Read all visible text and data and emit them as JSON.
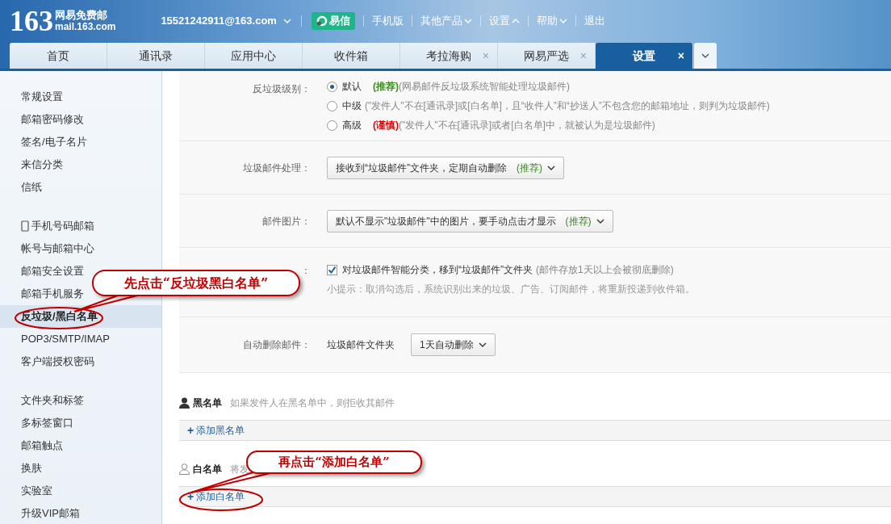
{
  "header": {
    "logo": {
      "number": "163",
      "name": "网易免费邮",
      "domain": "mail.163.com"
    },
    "account": "15521242911@163.com",
    "yixin": "易信",
    "links": [
      {
        "label": "手机版",
        "menu": false
      },
      {
        "label": "其他产品",
        "menu": true,
        "expanded": false
      },
      {
        "label": "设置",
        "menu": true,
        "expanded": true
      },
      {
        "label": "帮助",
        "menu": true,
        "expanded": false
      },
      {
        "label": "退出",
        "menu": false
      }
    ]
  },
  "tabs": [
    {
      "label": "首页",
      "selected": false
    },
    {
      "label": "通讯录",
      "selected": false
    },
    {
      "label": "应用中心",
      "selected": false
    },
    {
      "label": "收件箱",
      "selected": false
    },
    {
      "label": "考拉海购",
      "selected": false,
      "close": "×"
    },
    {
      "label": "网易严选",
      "selected": false,
      "close": "×"
    },
    {
      "label": "设置",
      "selected": true,
      "close": "×"
    }
  ],
  "sidebar": {
    "groups": [
      [
        {
          "label": "常规设置",
          "kind": "plain",
          "selected": false
        },
        {
          "label": "邮箱密码修改",
          "kind": "plain",
          "selected": false
        },
        {
          "label": "签名/电子名片",
          "kind": "plain",
          "selected": false
        },
        {
          "label": "来信分类",
          "kind": "plain",
          "selected": false
        },
        {
          "label": "信纸",
          "kind": "plain",
          "selected": false
        }
      ],
      [
        {
          "label": "手机号码邮箱",
          "kind": "phone",
          "selected": false
        },
        {
          "label": "帐号与邮箱中心",
          "kind": "plain",
          "selected": false
        },
        {
          "label": "邮箱安全设置",
          "kind": "plain",
          "selected": false
        },
        {
          "label": "邮箱手机服务",
          "kind": "plain",
          "selected": false
        },
        {
          "label": "反垃圾/黑白名单",
          "kind": "plain",
          "selected": true
        },
        {
          "label": "POP3/SMTP/IMAP",
          "kind": "plain",
          "selected": false
        },
        {
          "label": "客户端授权密码",
          "kind": "plain",
          "selected": false
        }
      ],
      [
        {
          "label": "文件夹和标签",
          "kind": "plain",
          "selected": false
        },
        {
          "label": "多标签窗口",
          "kind": "plain",
          "selected": false
        },
        {
          "label": "邮箱触点",
          "kind": "plain",
          "selected": false
        },
        {
          "label": "换肤",
          "kind": "plain",
          "selected": false
        },
        {
          "label": "实验室",
          "kind": "plain",
          "selected": false
        },
        {
          "label": "升级VIP邮箱",
          "kind": "plain",
          "selected": false
        }
      ]
    ]
  },
  "settings": [
    {
      "kind": "radio",
      "label": "反垃圾级别：",
      "options": [
        {
          "label": "默认",
          "selected": true,
          "tag": {
            "text": "(推荐)",
            "color": "#3a8a1f"
          },
          "description": "(网易邮件反垃圾系统智能处理垃圾邮件)"
        },
        {
          "label": "中级",
          "selected": false,
          "description": "(\"发件人\"不在[通讯录]或[白名单]，且“收件人”和“抄送人”不包含您的邮箱地址，则判为垃圾邮件)"
        },
        {
          "label": "高级",
          "selected": false,
          "tag": {
            "text": "(谨慎)",
            "color": "#e60000"
          },
          "description": "(\"发件人\"不在[通讯录]或者[白名单]中，就被认为是垃圾邮件)"
        }
      ]
    },
    {
      "kind": "select",
      "label": "垃圾邮件处理：",
      "value": "接收到“垃圾邮件”文件夹，定期自动删除",
      "tag": "(推荐)"
    },
    {
      "kind": "select",
      "label": "邮件图片：",
      "value": "默认不显示\"垃圾邮件\"中的图片，要手动点击才显示",
      "tag": "(推荐)"
    },
    {
      "kind": "checkbox",
      "label": "：",
      "checked": true,
      "text": "对垃圾邮件智能分类，移到“垃圾邮件”文件夹",
      "note": "(邮件存放1天以上会被彻底删除)",
      "hint": "小提示：取消勾选后，系统识别出来的垃圾、广告、订阅邮件，将重新投递到收件箱。"
    },
    {
      "kind": "inline-select",
      "label": "自动删除邮件：",
      "prefix": "垃圾邮件文件夹",
      "value": "1天自动删除"
    }
  ],
  "lists": [
    {
      "kind": "blacklist",
      "title": "黑名单",
      "description": "如果发件人在黑名单中，则拒收其邮件",
      "add": "添加黑名单",
      "plus": "+"
    },
    {
      "kind": "whitelist",
      "title": "白名单",
      "description": "将发",
      "add": "添加白名单",
      "plus": "+"
    }
  ],
  "annotations": [
    {
      "kind": "sidebar",
      "text": "先点击“反垃圾黑白名单”"
    },
    {
      "kind": "whitelist",
      "text": "再点击“添加白名单”"
    }
  ]
}
